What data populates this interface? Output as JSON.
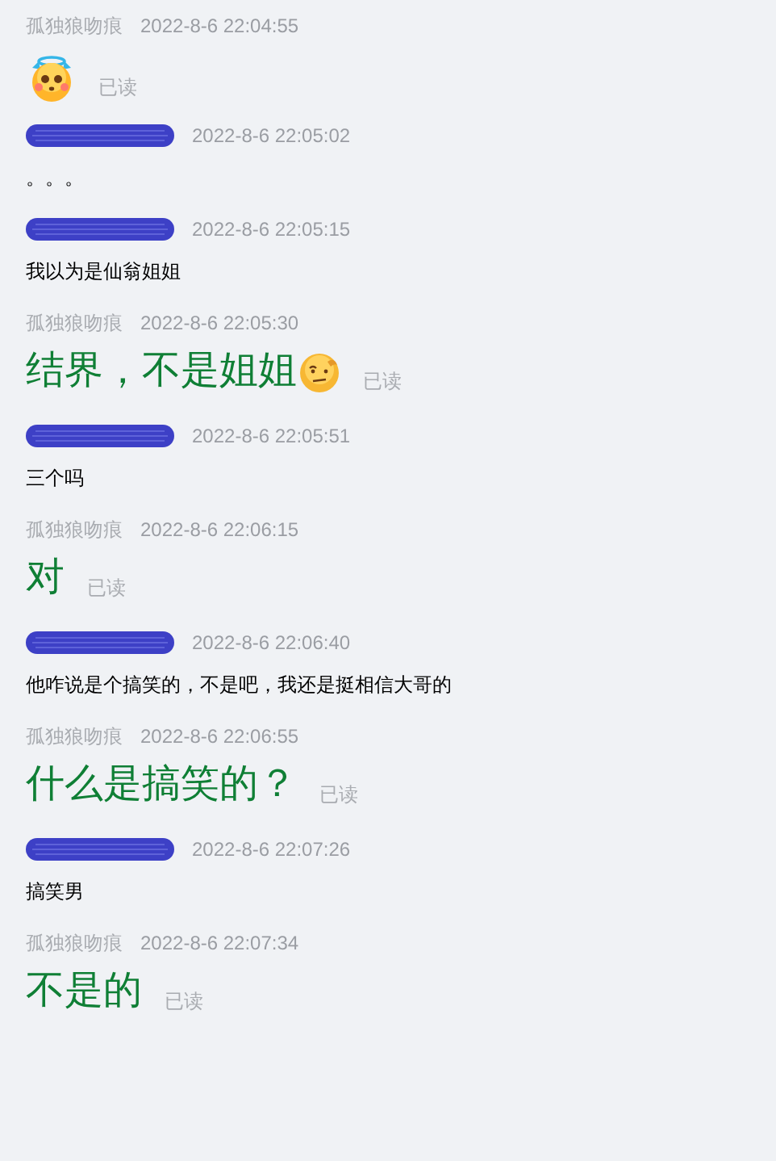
{
  "messages": [
    {
      "kind": "self",
      "sender": "孤独狼吻痕",
      "time": "2022-8-6 22:04:55",
      "emoji": {
        "kind": "halo-face"
      },
      "read": "已读"
    },
    {
      "kind": "other",
      "sender_redacted": true,
      "time": "2022-8-6 22:05:02",
      "text": "。。。"
    },
    {
      "kind": "other",
      "sender_redacted": true,
      "time": "2022-8-6 22:05:15",
      "text": "我以为是仙翁姐姐"
    },
    {
      "kind": "self",
      "sender": "孤独狼吻痕",
      "time": "2022-8-6 22:05:30",
      "text": "结界，不是姐姐",
      "emoji": {
        "kind": "skeptical-face"
      },
      "read": "已读"
    },
    {
      "kind": "other",
      "sender_redacted": true,
      "time": "2022-8-6 22:05:51",
      "text": "三个吗"
    },
    {
      "kind": "self",
      "sender": "孤独狼吻痕",
      "time": "2022-8-6 22:06:15",
      "text": "对",
      "read": "已读"
    },
    {
      "kind": "other",
      "sender_redacted": true,
      "time": "2022-8-6 22:06:40",
      "text": "他咋说是个搞笑的，不是吧，我还是挺相信大哥的"
    },
    {
      "kind": "self",
      "sender": "孤独狼吻痕",
      "time": "2022-8-6 22:06:55",
      "text": "什么是搞笑的？",
      "read": "已读"
    },
    {
      "kind": "other",
      "sender_redacted": true,
      "time": "2022-8-6 22:07:26",
      "text": "搞笑男"
    },
    {
      "kind": "self",
      "sender": "孤独狼吻痕",
      "time": "2022-8-6 22:07:34",
      "text": "不是的",
      "read": "已读"
    }
  ]
}
